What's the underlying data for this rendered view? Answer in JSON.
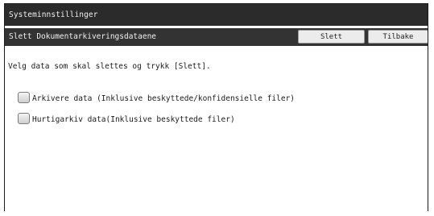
{
  "window": {
    "title": "Systeminnstillinger"
  },
  "subheader": {
    "title": "Slett Dokumentarkiveringsdataene",
    "delete_label": "Slett",
    "back_label": "Tilbake"
  },
  "main": {
    "instruction": "Velg data som skal slettes og trykk [Slett].",
    "options": [
      {
        "label": "Arkivere data (Inklusive beskyttede/konfidensielle filer)",
        "checked": false
      },
      {
        "label": "Hurtigarkiv data(Inklusive beskyttede filer)",
        "checked": false
      }
    ]
  }
}
